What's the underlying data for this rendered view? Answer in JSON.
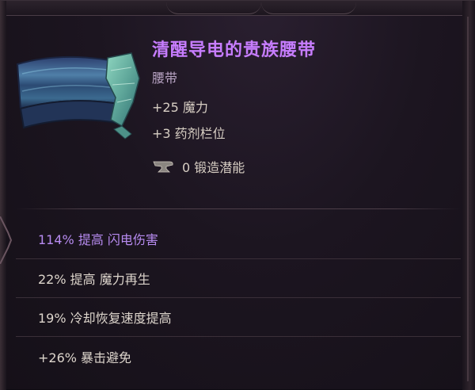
{
  "item": {
    "name": "清醒导电的贵族腰带",
    "type": "腰带",
    "stats": [
      "+25 魔力",
      "+3 药剂栏位"
    ],
    "forge_potential": "0 锻造潜能",
    "icon": "belt-icon",
    "name_color": "#c77dff"
  },
  "affixes": [
    {
      "text": "114% 提高 闪电伤害",
      "color": "#b78bf0"
    },
    {
      "text": "22% 提高 魔力再生",
      "color": "#ddd5cc"
    },
    {
      "text": "19% 冷却恢复速度提高",
      "color": "#ddd5cc"
    },
    {
      "text": "+26% 暴击避免",
      "color": "#ddd5cc"
    }
  ]
}
